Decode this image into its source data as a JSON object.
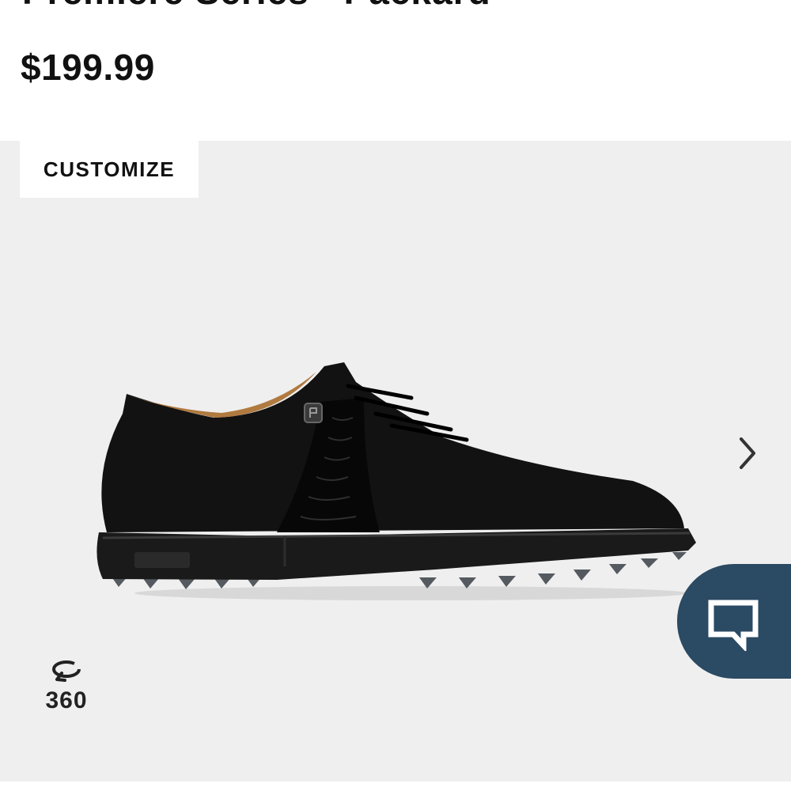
{
  "product": {
    "title": "Premiere Series - Packard",
    "price": "$199.99"
  },
  "gallery": {
    "customize_label": "CUSTOMIZE",
    "view360_label": "360",
    "image_subject": "black golf shoe",
    "next_icon": "chevron-right-icon",
    "rotate_icon": "rotate-360-icon"
  },
  "chat": {
    "icon": "chat-bubble-icon",
    "color": "#2b4a63"
  },
  "colors": {
    "background": "#ffffff",
    "gallery_background": "#efefef",
    "text": "#111111",
    "chat_accent": "#2b4a63"
  }
}
